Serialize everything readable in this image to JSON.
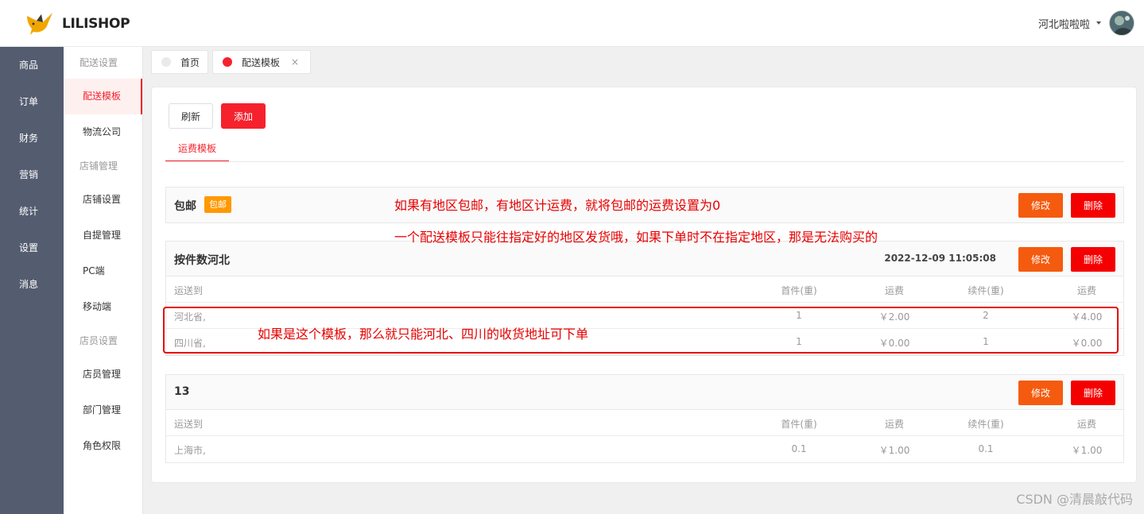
{
  "brand": {
    "name": "LILISHOP"
  },
  "user": {
    "name": "河北啦啦啦"
  },
  "sidebar_main": [
    "商品",
    "订单",
    "财务",
    "营销",
    "统计",
    "设置",
    "消息"
  ],
  "sidebar_sub": {
    "group1": "配送设置",
    "item_delivery_template": "配送模板",
    "item_logistics": "物流公司",
    "group2": "店铺管理",
    "item_store_settings": "店铺设置",
    "item_pickup": "自提管理",
    "item_pc": "PC端",
    "item_mobile": "移动端",
    "group3": "店员设置",
    "item_clerk": "店员管理",
    "item_dept": "部门管理",
    "item_roles": "角色权限"
  },
  "tabs": {
    "home": "首页",
    "delivery": "配送模板",
    "close": "×"
  },
  "toolbar": {
    "refresh": "刷新",
    "add": "添加"
  },
  "inner_tab": "运费模板",
  "columns": {
    "area": "运送到",
    "first": "首件(重)",
    "fee": "运费",
    "additional": "续件(重)",
    "additional_fee": "运费"
  },
  "actions": {
    "edit": "修改",
    "delete": "删除"
  },
  "templates": [
    {
      "title": "包邮",
      "badge": "包邮"
    },
    {
      "title": "按件数河北",
      "date": "2022-12-09 11:05:08",
      "rows": [
        {
          "area": "河北省,",
          "first": "1",
          "fee": "￥2.00",
          "additional": "2",
          "additional_fee": "￥4.00"
        },
        {
          "area": "四川省,",
          "first": "1",
          "fee": "￥0.00",
          "additional": "1",
          "additional_fee": "￥0.00"
        }
      ]
    },
    {
      "title": "13",
      "rows": [
        {
          "area": "上海市,",
          "first": "0.1",
          "fee": "￥1.00",
          "additional": "0.1",
          "additional_fee": "￥1.00"
        }
      ]
    }
  ],
  "annotations": {
    "note1": "如果有地区包邮，有地区计运费，就将包邮的运费设置为0",
    "note2": "一个配送模板只能往指定好的地区发货哦，如果下单时不在指定地区，那是无法购买的",
    "note3": "如果是这个模板，那么就只能河北、四川的收货地址可下单"
  },
  "watermark": "CSDN @清晨敲代码",
  "colors": {
    "accent": "#f5222d",
    "edit": "#f55b0f",
    "delete": "#f50000",
    "badge": "#ff9900",
    "sidebar": "#545c70"
  }
}
